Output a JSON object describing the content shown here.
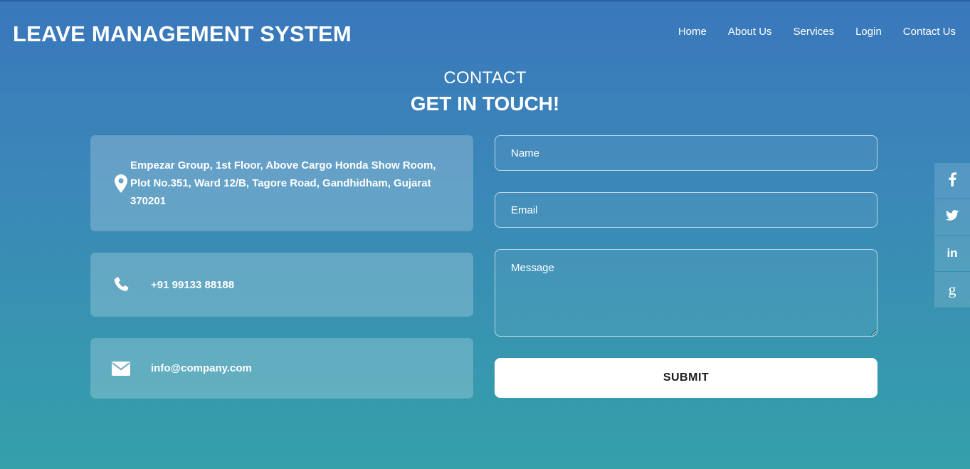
{
  "brand": {
    "title": "LEAVE MANAGEMENT SYSTEM"
  },
  "nav": {
    "items": [
      {
        "label": "Home"
      },
      {
        "label": "About Us"
      },
      {
        "label": "Services"
      },
      {
        "label": "Login"
      },
      {
        "label": "Contact Us"
      }
    ]
  },
  "section": {
    "kicker": "CONTACT",
    "title": "GET IN TOUCH!"
  },
  "contact_cards": {
    "address": {
      "icon": "map-pin-icon",
      "line1": "Empezar Group, 1st Floor, Above Cargo Honda Show Room,",
      "line2": "Plot No.351, Ward 12/B, Tagore Road, Gandhidham, Gujarat",
      "line3": "370201"
    },
    "phone": {
      "icon": "phone-icon",
      "text": "+91 99133 88188"
    },
    "email": {
      "icon": "envelope-icon",
      "text": "info@company.com"
    }
  },
  "form": {
    "name_placeholder": "Name",
    "email_placeholder": "Email",
    "message_placeholder": "Message",
    "submit_label": "SUBMIT"
  },
  "social": {
    "items": [
      {
        "icon": "facebook-icon",
        "glyph": "f"
      },
      {
        "icon": "twitter-icon",
        "glyph": ""
      },
      {
        "icon": "linkedin-icon",
        "glyph": "in"
      },
      {
        "icon": "google-plus-icon",
        "glyph": "g"
      }
    ]
  },
  "colors": {
    "gradient_top": "#3a77bc",
    "gradient_bottom": "#35a0aa",
    "text": "#ffffff",
    "button_bg": "#ffffff",
    "button_text": "#1a1a1a"
  }
}
